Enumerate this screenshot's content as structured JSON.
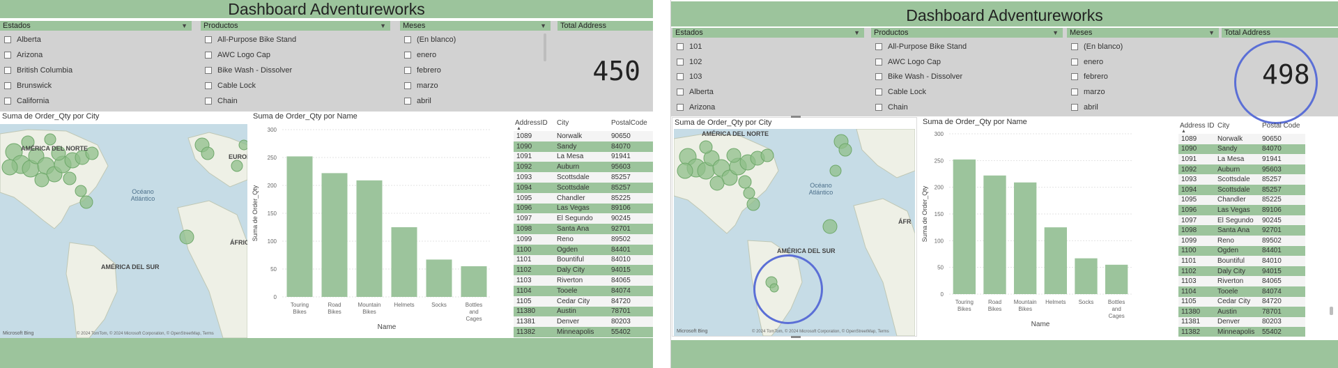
{
  "colors": {
    "green": "#9cc49c",
    "bar": "#9cc49c",
    "slicer_bg": "#d2d2d2",
    "annotation": "#5b6fd6"
  },
  "left": {
    "title": "Dashboard Adventureworks",
    "slicers": {
      "estados": {
        "header": "Estados",
        "items": [
          "Alberta",
          "Arizona",
          "British Columbia",
          "Brunswick",
          "California"
        ]
      },
      "productos": {
        "header": "Productos",
        "items": [
          "All-Purpose Bike Stand",
          "AWC Logo Cap",
          "Bike Wash - Dissolver",
          "Cable Lock",
          "Chain"
        ]
      },
      "meses": {
        "header": "Meses",
        "items": [
          "(En blanco)",
          "enero",
          "febrero",
          "marzo",
          "abril"
        ]
      }
    },
    "kpi": {
      "label": "Total Address",
      "value": "450"
    },
    "map": {
      "title": "Suma de Order_Qty por City",
      "labels": {
        "na": "AMÉRICA DEL NORTE",
        "sa": "AMÉRICA DEL SUR",
        "eu": "EUROPA",
        "af": "ÁFRICA",
        "ocean": "Océano Atlántico"
      },
      "bing": "Microsoft Bing",
      "copyright": "© 2024 TomTom, © 2024 Microsoft Corporation, © OpenStreetMap, Terms"
    },
    "chart_title": "Suma de Order_Qty por Name",
    "table": {
      "headers": [
        "AddressID",
        "City",
        "PostalCode"
      ],
      "rows": [
        [
          "1089",
          "Norwalk",
          "90650"
        ],
        [
          "1090",
          "Sandy",
          "84070"
        ],
        [
          "1091",
          "La Mesa",
          "91941"
        ],
        [
          "1092",
          "Auburn",
          "95603"
        ],
        [
          "1093",
          "Scottsdale",
          "85257"
        ],
        [
          "1094",
          "Scottsdale",
          "85257"
        ],
        [
          "1095",
          "Chandler",
          "85225"
        ],
        [
          "1096",
          "Las Vegas",
          "89106"
        ],
        [
          "1097",
          "El Segundo",
          "90245"
        ],
        [
          "1098",
          "Santa Ana",
          "92701"
        ],
        [
          "1099",
          "Reno",
          "89502"
        ],
        [
          "1100",
          "Ogden",
          "84401"
        ],
        [
          "1101",
          "Bountiful",
          "84010"
        ],
        [
          "1102",
          "Daly City",
          "94015"
        ],
        [
          "1103",
          "Riverton",
          "84065"
        ],
        [
          "1104",
          "Tooele",
          "84074"
        ],
        [
          "1105",
          "Cedar City",
          "84720"
        ],
        [
          "11380",
          "Austin",
          "78701"
        ],
        [
          "11381",
          "Denver",
          "80203"
        ],
        [
          "11382",
          "Minneapolis",
          "55402"
        ]
      ]
    }
  },
  "right": {
    "title": "Dashboard Adventureworks",
    "slicers": {
      "estados": {
        "header": "Estados",
        "items": [
          "101",
          "102",
          "103",
          "Alberta",
          "Arizona"
        ]
      },
      "productos": {
        "header": "Productos",
        "items": [
          "All-Purpose Bike Stand",
          "AWC Logo Cap",
          "Bike Wash - Dissolver",
          "Cable Lock",
          "Chain"
        ]
      },
      "meses": {
        "header": "Meses",
        "items": [
          "(En blanco)",
          "enero",
          "febrero",
          "marzo",
          "abril"
        ]
      }
    },
    "kpi": {
      "label": "Total Address",
      "value": "498"
    },
    "map": {
      "title": "Suma de Order_Qty por City",
      "labels": {
        "na": "AMÉRICA DEL NORTE",
        "sa": "AMÉRICA DEL SUR",
        "af": "ÁFR",
        "ocean": "Océano Atlántico"
      },
      "bing": "Microsoft Bing",
      "copyright": "© 2024 TomTom, © 2024 Microsoft Corporation, © OpenStreetMap, Terms"
    },
    "chart_title": "Suma de Order_Qty por Name",
    "table": {
      "headers": [
        "Address ID",
        "City",
        "Postal Code"
      ],
      "rows": [
        [
          "1089",
          "Norwalk",
          "90650"
        ],
        [
          "1090",
          "Sandy",
          "84070"
        ],
        [
          "1091",
          "La Mesa",
          "91941"
        ],
        [
          "1092",
          "Auburn",
          "95603"
        ],
        [
          "1093",
          "Scottsdale",
          "85257"
        ],
        [
          "1094",
          "Scottsdale",
          "85257"
        ],
        [
          "1095",
          "Chandler",
          "85225"
        ],
        [
          "1096",
          "Las Vegas",
          "89106"
        ],
        [
          "1097",
          "El Segundo",
          "90245"
        ],
        [
          "1098",
          "Santa Ana",
          "92701"
        ],
        [
          "1099",
          "Reno",
          "89502"
        ],
        [
          "1100",
          "Ogden",
          "84401"
        ],
        [
          "1101",
          "Bountiful",
          "84010"
        ],
        [
          "1102",
          "Daly City",
          "94015"
        ],
        [
          "1103",
          "Riverton",
          "84065"
        ],
        [
          "1104",
          "Tooele",
          "84074"
        ],
        [
          "1105",
          "Cedar City",
          "84720"
        ],
        [
          "11380",
          "Austin",
          "78701"
        ],
        [
          "11381",
          "Denver",
          "80203"
        ],
        [
          "11382",
          "Minneapolis",
          "55402"
        ]
      ]
    }
  },
  "chart_data": [
    {
      "type": "bar",
      "title": "Suma de Order_Qty por Name",
      "xlabel": "Name",
      "ylabel": "Suma de Order_Qty",
      "categories": [
        "Touring Bikes",
        "Road Bikes",
        "Mountain Bikes",
        "Helmets",
        "Socks",
        "Bottles and Cages"
      ],
      "values": [
        252,
        222,
        209,
        125,
        67,
        55
      ],
      "ylim": [
        0,
        300
      ],
      "yticks": [
        0,
        50,
        100,
        150,
        200,
        250,
        300
      ],
      "grid": true
    },
    {
      "type": "bar",
      "title": "Suma de Order_Qty por Name",
      "xlabel": "Name",
      "ylabel": "Suma de Order_Qty",
      "categories": [
        "Touring Bikes",
        "Road Bikes",
        "Mountain Bikes",
        "Helmets",
        "Socks",
        "Bottles and Cages"
      ],
      "values": [
        252,
        222,
        209,
        125,
        67,
        55
      ],
      "ylim": [
        0,
        300
      ],
      "yticks": [
        0,
        50,
        100,
        150,
        200,
        250,
        300
      ],
      "grid": true
    }
  ]
}
